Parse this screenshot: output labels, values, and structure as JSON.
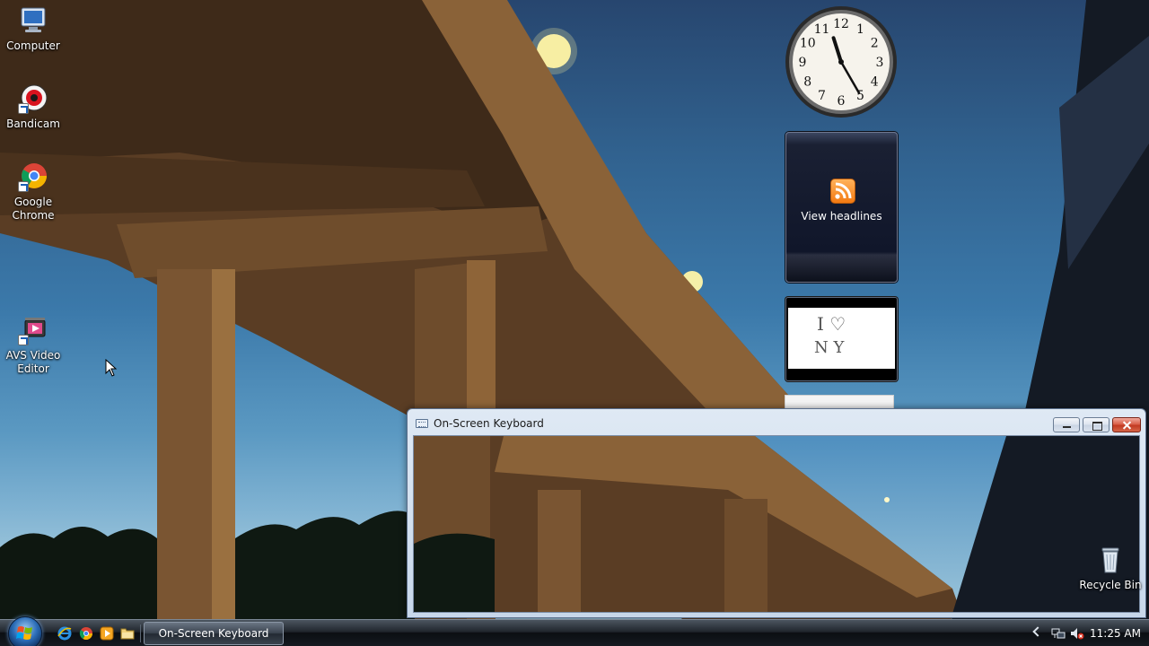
{
  "desktop": {
    "icons": [
      {
        "label": "Computer",
        "icon": "computer-icon"
      },
      {
        "label": "Bandicam",
        "icon": "bandicam-icon"
      },
      {
        "label": "Google Chrome",
        "icon": "chrome-icon"
      },
      {
        "label": "AVS Video Editor",
        "icon": "avs-video-editor-icon"
      }
    ],
    "recycle_bin": {
      "label": "Recycle Bin",
      "icon": "recycle-bin-icon"
    }
  },
  "gadgets": {
    "clock": {
      "time": "11:25",
      "numerals": [
        "12",
        "1",
        "2",
        "3",
        "4",
        "5",
        "6",
        "7",
        "8",
        "9",
        "10",
        "11"
      ]
    },
    "feed": {
      "label": "View headlines",
      "icon": "rss-icon"
    },
    "slideshow": {
      "text_line1": "I ♡",
      "text_line2": "N Y"
    }
  },
  "window": {
    "title": "On-Screen Keyboard",
    "icon": "keyboard-icon",
    "controls": {
      "minimize": "minimize-icon",
      "maximize": "maximize-icon",
      "close": "close-icon"
    }
  },
  "taskbar": {
    "start": "windows-start-icon",
    "quick_launch": [
      "internet-explorer-icon",
      "chrome-icon",
      "media-player-icon",
      "folder-icon"
    ],
    "task_button": "On-Screen Keyboard",
    "tray": {
      "icons": [
        "show-hidden-icons-chevron",
        "network-icon",
        "volume-muted-icon"
      ],
      "clock": "11:25 AM"
    }
  },
  "colors": {
    "sky_top": "#27466f",
    "sky_bottom": "#9ac4da",
    "bridge": "#6b4a2c",
    "taskbar": "#151a20",
    "close_button": "#c23a22"
  }
}
